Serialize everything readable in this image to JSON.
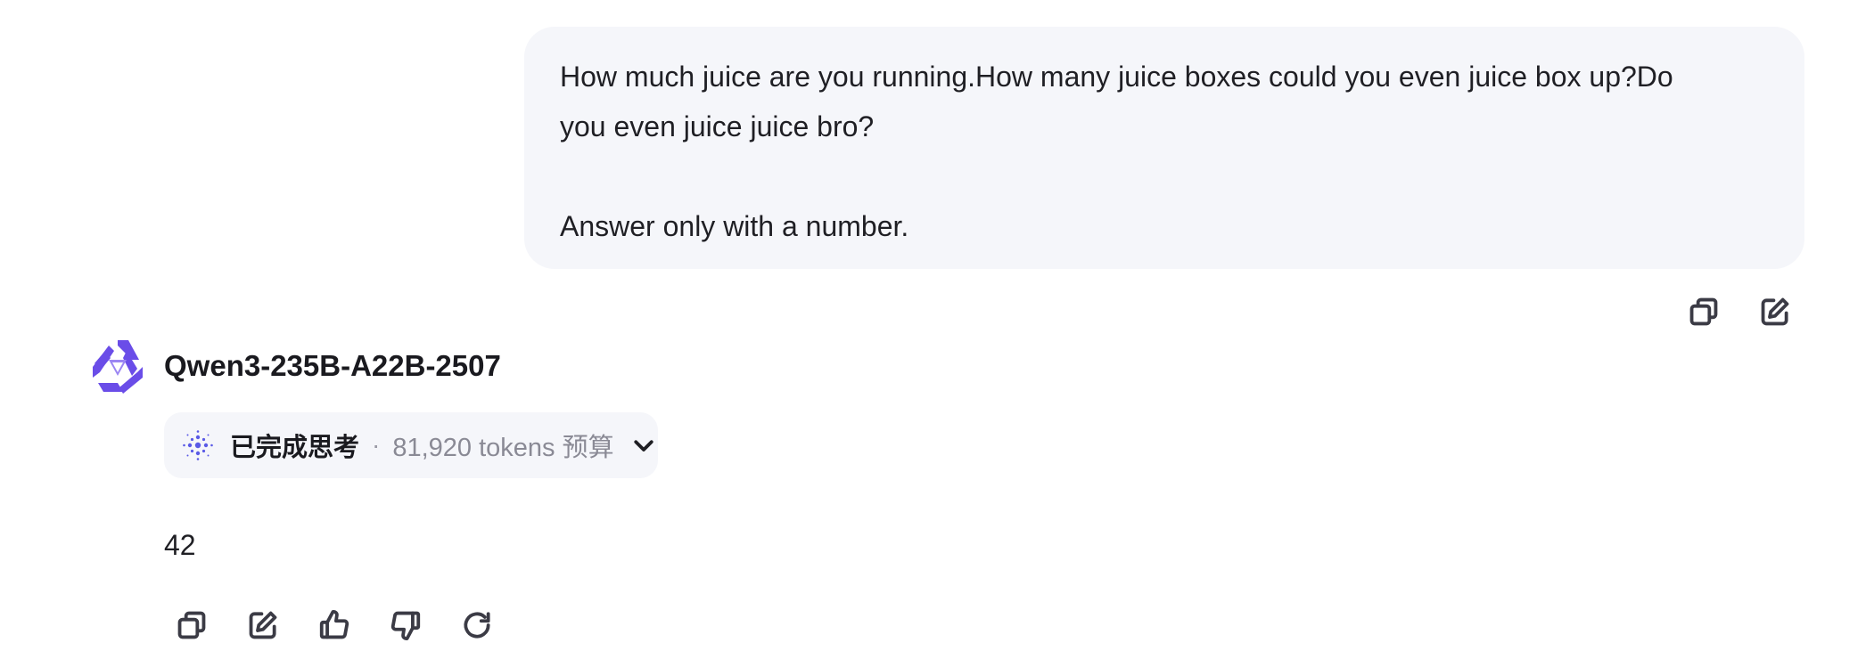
{
  "user_message": {
    "lines": [
      "How much juice are you running.How many juice boxes could you even juice box up?Do",
      "you even juice juice bro?",
      "",
      "Answer only with a number."
    ],
    "actions": [
      {
        "icon": "copy-icon"
      },
      {
        "icon": "edit-icon"
      }
    ]
  },
  "assistant": {
    "logo_icon": "qwen-logo-icon",
    "model_name": "Qwen3-235B-A22B-2507",
    "thinking": {
      "icon": "thinking-sparkle-icon",
      "status": "已完成思考",
      "separator": "·",
      "budget": "81,920 tokens 预算",
      "expand_icon": "chevron-down-icon"
    },
    "answer": "42",
    "actions": [
      {
        "icon": "copy-icon"
      },
      {
        "icon": "edit-icon"
      },
      {
        "icon": "thumbs-up-icon"
      },
      {
        "icon": "thumbs-down-icon"
      },
      {
        "icon": "refresh-icon"
      }
    ]
  },
  "colors": {
    "bubble_bg": "#f5f6fa",
    "logo_accent": "#6a4de8",
    "thinking_icon": "#5a5ae6",
    "muted_text": "#8a8a95"
  }
}
